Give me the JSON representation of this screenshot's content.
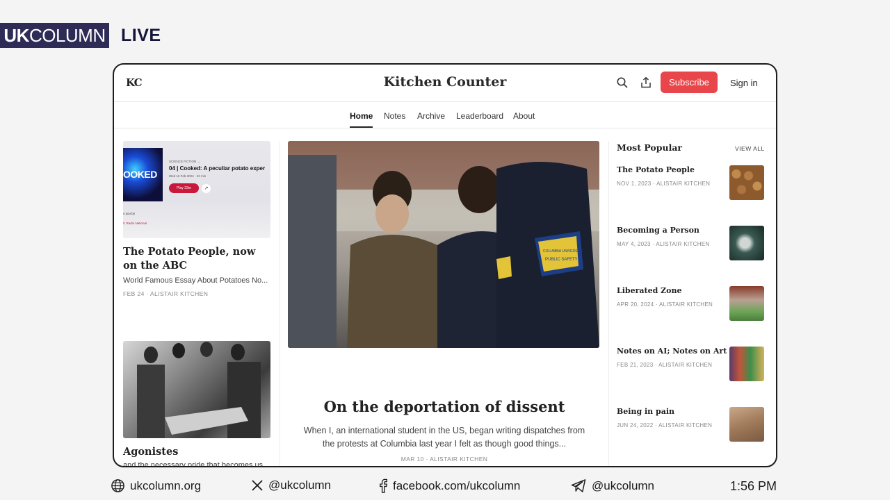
{
  "overlay": {
    "brand_bold": "UK",
    "brand_rest": "COLUMN",
    "live": "LIVE",
    "clock": "1:56 PM",
    "footer": [
      {
        "icon": "globe-icon",
        "text": "ukcolumn.org"
      },
      {
        "icon": "x-icon",
        "text": "@ukcolumn"
      },
      {
        "icon": "facebook-icon",
        "text": "facebook.com/ukcolumn"
      },
      {
        "icon": "telegram-icon",
        "text": "@ukcolumn"
      }
    ]
  },
  "site": {
    "logo": "KC",
    "title": "Kitchen Counter",
    "subscribe_label": "Subscribe",
    "signin_label": "Sign in",
    "accent": "#e8464a"
  },
  "nav": {
    "items": [
      {
        "label": "Home",
        "active": true
      },
      {
        "label": "Notes"
      },
      {
        "label": "Archive"
      },
      {
        "label": "Leaderboard"
      },
      {
        "label": "About"
      }
    ]
  },
  "left_posts": [
    {
      "title": "The Potato People, now on the ABC",
      "subtitle": "World Famous Essay About Potatoes No...",
      "meta": "FEB 24 · ALISTAIR KITCHEN",
      "thumb_text": {
        "art_word": "OOKED",
        "episode": "04 | Cooked: A peculiar potato exper",
        "play": "Play 23m",
        "tiny_kicker": "SCIENCE FICTION →",
        "tiny_date": "Wed 16 Feb 2024 · 23 min",
        "tiny_presented": "o you by",
        "tiny_network": "C Radio National"
      }
    },
    {
      "title": "Agonistes",
      "subtitle": "and the necessary pride that becomes us..."
    }
  ],
  "hero": {
    "title": "On the deportation of dissent",
    "subtitle": "When I, an international student in the US, began writing dispatches from the protests at Columbia last year I felt as though good things...",
    "meta": "MAR 10 · ALISTAIR KITCHEN",
    "badge_text_1": "COLUMBIA UNIVERSITY",
    "badge_text_2": "PUBLIC SAFETY"
  },
  "popular": {
    "heading": "Most Popular",
    "view_all": "VIEW ALL",
    "items": [
      {
        "title": "The Potato People",
        "meta": "NOV 1, 2023 · ALISTAIR KITCHEN"
      },
      {
        "title": "Becoming a Person",
        "meta": "MAY 4, 2023 · ALISTAIR KITCHEN"
      },
      {
        "title": "Liberated Zone",
        "meta": "APR 20, 2024 · ALISTAIR KITCHEN"
      },
      {
        "title": "Notes on AI; Notes on Art",
        "meta": "FEB 21, 2023 · ALISTAIR KITCHEN"
      },
      {
        "title": "Being in pain",
        "meta": "JUN 24, 2022 · ALISTAIR KITCHEN"
      }
    ]
  }
}
